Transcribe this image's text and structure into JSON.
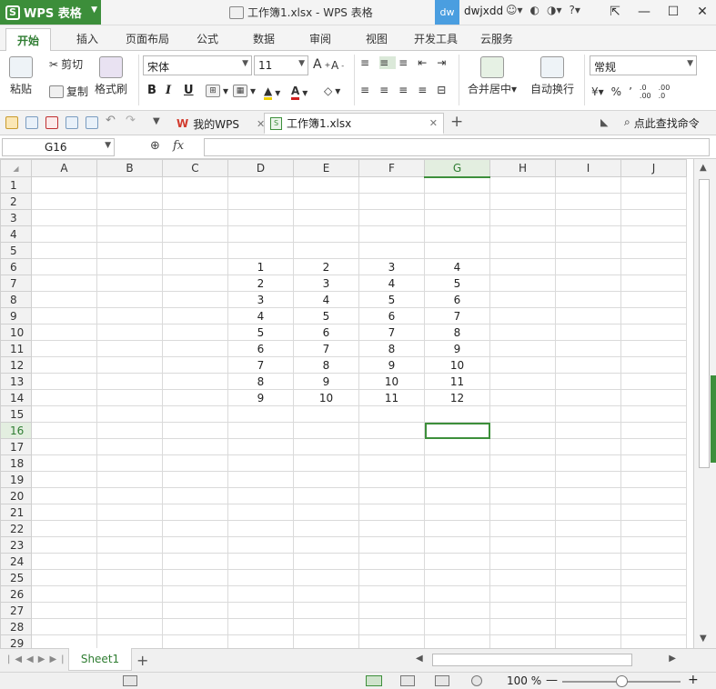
{
  "titlebar": {
    "app_name": "WPS 表格",
    "logo_letter": "S",
    "window_title": "工作簿1.xlsx - WPS 表格",
    "user_badge": "dw",
    "username": "dwjxdd",
    "help": "?"
  },
  "menu": {
    "tabs": [
      "开始",
      "插入",
      "页面布局",
      "公式",
      "数据",
      "审阅",
      "视图",
      "开发工具",
      "云服务"
    ]
  },
  "ribbon": {
    "paste": "粘贴",
    "cut": "剪切",
    "copy": "复制",
    "format_painter": "格式刷",
    "font_name": "宋体",
    "font_size": "11",
    "bold": "B",
    "italic": "I",
    "underline": "U",
    "merge_center": "合并居中",
    "wrap_text": "自动换行",
    "number_format": "常规",
    "percent": "%",
    "comma": "’"
  },
  "quickbar": {
    "tabs": [
      {
        "label": "我的WPS"
      },
      {
        "label": "工作簿1.xlsx"
      }
    ],
    "search": "点此查找命令"
  },
  "formula": {
    "name_box": "G16",
    "fx": "fx",
    "value": ""
  },
  "sheet": {
    "columns": [
      "A",
      "B",
      "C",
      "D",
      "E",
      "F",
      "G",
      "H",
      "I",
      "J"
    ],
    "row_count": 29,
    "selected_cell": "G16",
    "data": [
      {
        "row": 6,
        "D": 1,
        "E": 2,
        "F": 3,
        "G": 4
      },
      {
        "row": 7,
        "D": 2,
        "E": 3,
        "F": 4,
        "G": 5
      },
      {
        "row": 8,
        "D": 3,
        "E": 4,
        "F": 5,
        "G": 6
      },
      {
        "row": 9,
        "D": 4,
        "E": 5,
        "F": 6,
        "G": 7
      },
      {
        "row": 10,
        "D": 5,
        "E": 6,
        "F": 7,
        "G": 8
      },
      {
        "row": 11,
        "D": 6,
        "E": 7,
        "F": 8,
        "G": 9
      },
      {
        "row": 12,
        "D": 7,
        "E": 8,
        "F": 9,
        "G": 10
      },
      {
        "row": 13,
        "D": 8,
        "E": 9,
        "F": 10,
        "G": 11
      },
      {
        "row": 14,
        "D": 9,
        "E": 10,
        "F": 11,
        "G": 12
      }
    ]
  },
  "sheetbar": {
    "sheets": [
      "Sheet1"
    ],
    "add": "+"
  },
  "status": {
    "zoom": "100 %",
    "zoom_fraction": 0.5
  },
  "colors": {
    "accent": "#3d8f3b",
    "app_button": "#3c8e3a",
    "user_badge": "#4a9ee0"
  }
}
